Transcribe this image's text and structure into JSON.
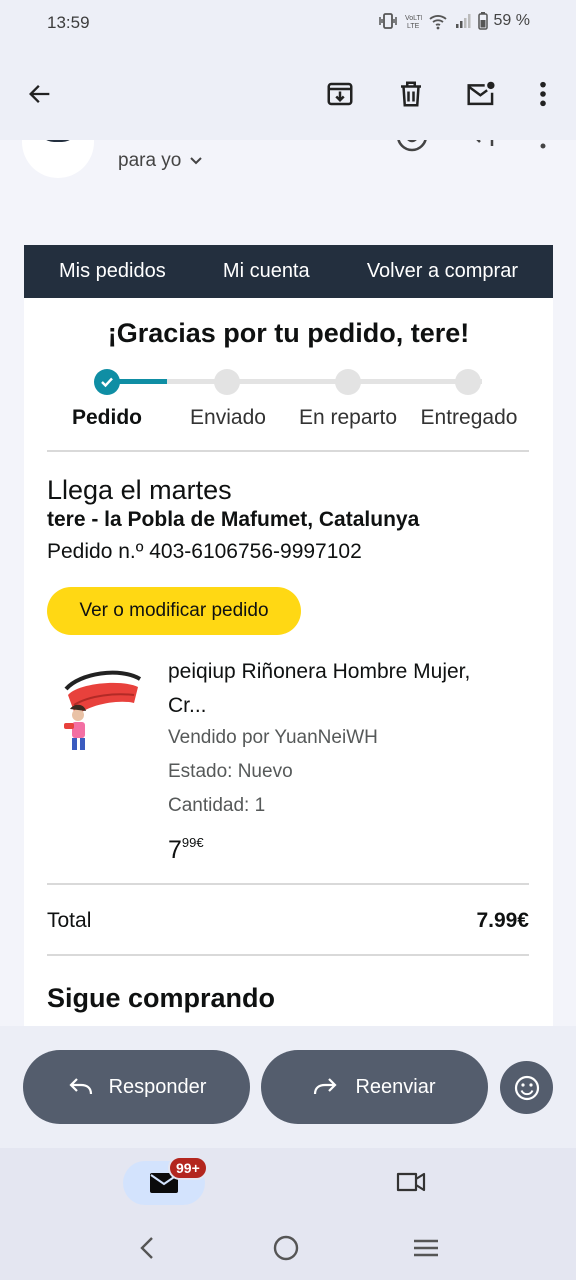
{
  "status_bar": {
    "time": "13:59",
    "battery": "59 %"
  },
  "header": {
    "recipient_label": "para yo"
  },
  "email": {
    "nav": [
      "Mis pedidos",
      "Mi cuenta",
      "Volver a comprar"
    ],
    "thanks": "¡Gracias por tu pedido, tere!",
    "progress": {
      "steps": [
        "Pedido",
        "Enviado",
        "En reparto",
        "Entregado"
      ],
      "current_step": 1
    },
    "arrival": "Llega el martes",
    "address": "tere - la Pobla de Mafumet, Catalunya",
    "order_number": "Pedido n.º 403-6106756-9997102",
    "view_button": "Ver o modificar pedido",
    "product": {
      "title_line1": "peiqiup Riñonera Hombre Mujer,",
      "title_line2": "Cr...",
      "seller": "Vendido por YuanNeiWH",
      "condition": "Estado: Nuevo",
      "quantity": "Cantidad: 1",
      "price_whole": "7",
      "price_fraction": "99€"
    },
    "total_label": "Total",
    "total_value": "7.99€",
    "keep_shopping": "Sigue comprando"
  },
  "actions": {
    "reply": "Responder",
    "forward": "Reenviar"
  },
  "bottom_nav": {
    "mail_badge": "99+"
  },
  "colors": {
    "amazon_nav": "#232f3e",
    "progress_accent": "#0f8ea4",
    "cta_yellow": "#ffd814",
    "action_pill": "#545d6d",
    "badge_red": "#b3261e"
  }
}
